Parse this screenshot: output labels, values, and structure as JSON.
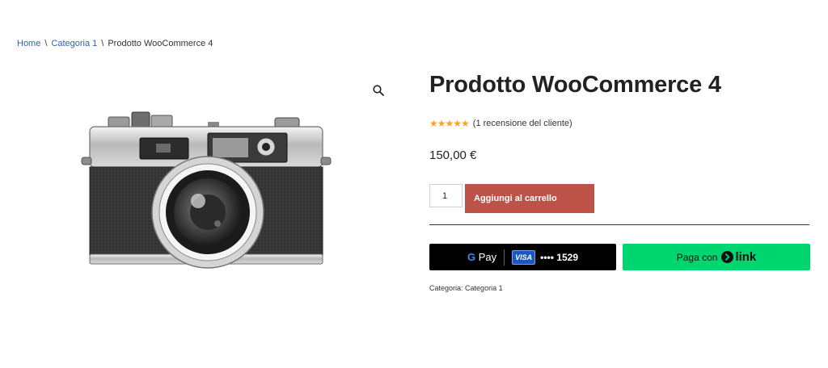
{
  "breadcrumb": {
    "home": "Home",
    "separator": "\\",
    "category": "Categoria 1",
    "current": "Prodotto WooCommerce 4"
  },
  "gallery": {
    "zoom_icon": "magnifier-icon",
    "image": "vintage-camera-photo"
  },
  "product": {
    "title": "Prodotto WooCommerce 4",
    "rating_stars": 5,
    "rating_max": 5,
    "star_color": "#f5a623",
    "review_text": "(1 recensione del cliente)",
    "price": "150,00 €"
  },
  "cart": {
    "quantity": "1",
    "add_label": "Aggiungi al carrello",
    "button_color": "#bd5249"
  },
  "payment": {
    "gpay_label": "Pay",
    "card_brand": "VISA",
    "card_number": "•••• 1529",
    "link_prefix": "Paga con",
    "link_label": "link",
    "link_color": "#00d66f"
  },
  "meta": {
    "category_label": "Categoria:",
    "category_value": "Categoria 1"
  }
}
